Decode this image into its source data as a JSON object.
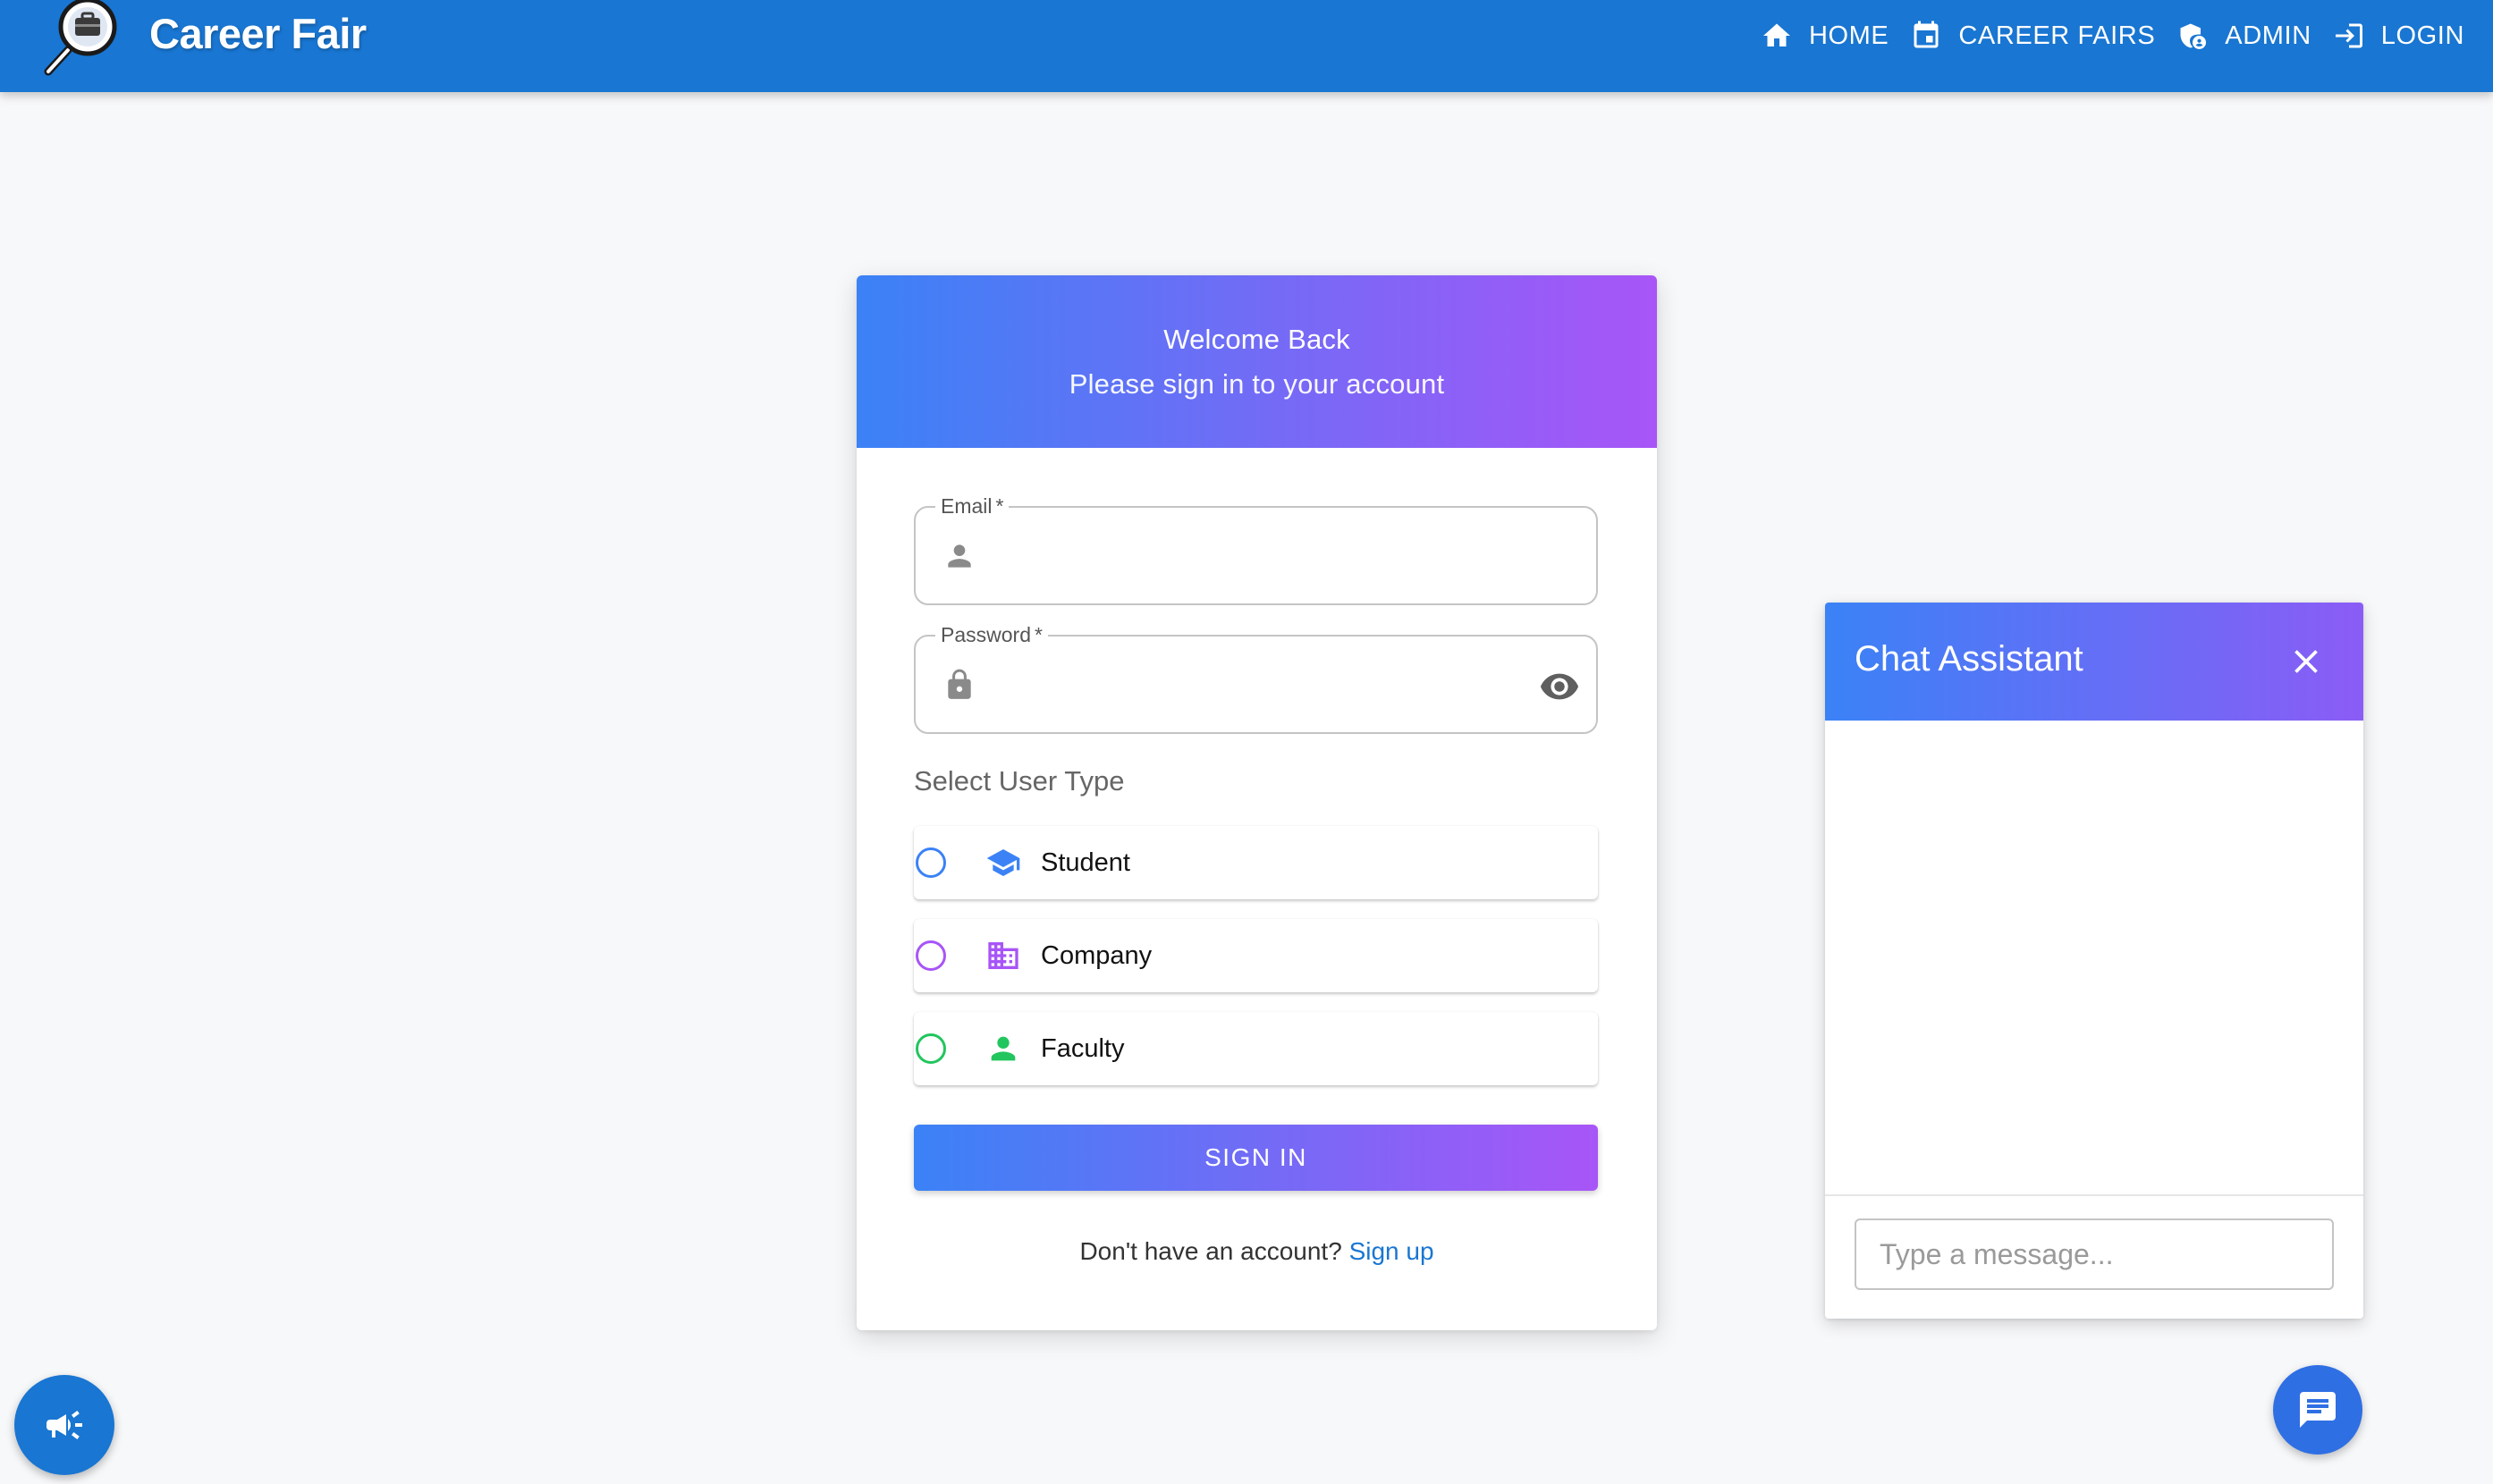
{
  "app": {
    "brand": "Career Fair",
    "colors": {
      "primary": "#1976d2",
      "gradient_start": "#3b82f6",
      "gradient_end": "#a855f7"
    }
  },
  "nav": {
    "items": [
      {
        "label": "HOME",
        "icon": "home-icon"
      },
      {
        "label": "CAREER FAIRS",
        "icon": "calendar-icon"
      },
      {
        "label": "ADMIN",
        "icon": "admin-shield-icon"
      },
      {
        "label": "LOGIN",
        "icon": "login-icon"
      }
    ]
  },
  "login": {
    "title": "Welcome Back",
    "subtitle": "Please sign in to your account",
    "email": {
      "label": "Email",
      "required_mark": "*",
      "value": "",
      "icon": "person-icon"
    },
    "password": {
      "label": "Password",
      "required_mark": "*",
      "value": "",
      "icon": "lock-icon",
      "toggle_icon": "eye-icon"
    },
    "user_type_label": "Select User Type",
    "user_types": [
      {
        "label": "Student",
        "icon": "school-icon",
        "color": "#3b82f6",
        "selected": false
      },
      {
        "label": "Company",
        "icon": "business-icon",
        "color": "#a855f7",
        "selected": false
      },
      {
        "label": "Faculty",
        "icon": "person-icon",
        "color": "#22c55e",
        "selected": false
      }
    ],
    "signin_label": "SIGN IN",
    "no_account_text": "Don't have an account?",
    "signup_link": "Sign up"
  },
  "chat": {
    "title": "Chat Assistant",
    "input_placeholder": "Type a message...",
    "input_value": ""
  },
  "fab": {
    "left_icon": "campaign-icon",
    "right_icon": "chat-icon"
  }
}
